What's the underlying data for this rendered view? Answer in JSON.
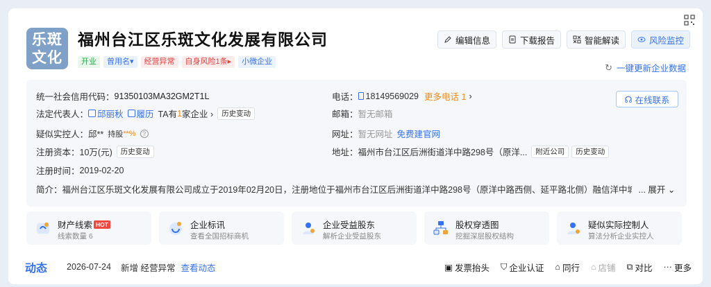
{
  "header": {
    "logo_text_line1": "乐斑",
    "logo_text_line2": "文化",
    "company_name": "福州台江区乐斑文化发展有限公司",
    "tags": [
      {
        "label": "开业",
        "style": "green"
      },
      {
        "label": "曾用名▾",
        "style": "blue"
      },
      {
        "label": "经营异常",
        "style": "red"
      },
      {
        "label": "自身风险1条▸",
        "style": "red"
      },
      {
        "label": "小微企业",
        "style": "blue"
      }
    ],
    "actions": [
      {
        "label": "编辑信息",
        "icon": "edit-icon"
      },
      {
        "label": "下载报告",
        "icon": "document-icon"
      },
      {
        "label": "智能解读",
        "icon": "ai-icon"
      },
      {
        "label": "风险监控",
        "icon": "eye-icon"
      }
    ],
    "refresh_label": "一键更新企业数据"
  },
  "info": {
    "credit_code_label": "统一社会信用代码：",
    "credit_code": "91350103MA32GM2T1L",
    "legal_rep_label": "法定代表人：",
    "legal_rep_name": "邱丽秋",
    "legal_rep_resume": "履历",
    "legal_rep_extra_prefix": "TA有",
    "legal_rep_extra_count": "1",
    "legal_rep_extra_suffix": "家企业 ›",
    "history_change": "历史变动",
    "controller_label": "疑似实控人：",
    "controller_name": "邱**",
    "controller_hold": "持股",
    "controller_pct": "**%",
    "capital_label": "注册资本：",
    "capital": "10万(元)",
    "reg_date_label": "注册时间：",
    "reg_date": "2019-02-20",
    "phone_label": "电话：",
    "phone": "18149569029",
    "more_phone": "更多电话 1",
    "email_label": "邮箱：",
    "email": "暂无邮箱",
    "website_label": "网址：",
    "website": "暂无网址",
    "website_link": "免费建官网",
    "address_label": "地址：",
    "address": "福州市台江区后洲街道洋中路298号（原洋...",
    "nearby": "附近公司",
    "intro_label": "简介：",
    "intro": "福州台江区乐斑文化发展有限公司成立于2019年02月20日，注册地位于福州市台江区后洲街道洋中路298号（原洋中路西侧、延平路北侧）融信洋中城（地",
    "expand": "... 展开 ⌄",
    "online_contact": "在线联系"
  },
  "features": [
    {
      "title": "财产线索",
      "badge": "HOT",
      "sub": "线索数量 6",
      "icon": "property-icon"
    },
    {
      "title": "企业标讯",
      "badge": "",
      "sub": "查看全国招标商机",
      "icon": "bid-icon"
    },
    {
      "title": "企业受益股东",
      "badge": "",
      "sub": "解析企业受益股东",
      "icon": "shareholder-icon"
    },
    {
      "title": "股权穿透图",
      "badge": "",
      "sub": "挖掘深层股权结构",
      "icon": "equity-chart-icon"
    },
    {
      "title": "疑似实际控制人",
      "badge": "",
      "sub": "算法分析企业实控人",
      "icon": "controller-icon"
    }
  ],
  "dynamics": {
    "label": "动态",
    "date": "2026-07-24",
    "text": "新增 经营异常",
    "link": "查看动态"
  },
  "tools": [
    {
      "label": "发票抬头",
      "icon": "invoice-icon",
      "enabled": true
    },
    {
      "label": "企业认证",
      "icon": "shield-icon",
      "enabled": true
    },
    {
      "label": "同行",
      "icon": "peer-icon",
      "enabled": true
    },
    {
      "label": "店铺",
      "icon": "store-icon",
      "enabled": false
    },
    {
      "label": "对比",
      "icon": "compare-icon",
      "enabled": true
    },
    {
      "label": "更多",
      "icon": "more-icon",
      "enabled": true
    }
  ],
  "colors": {
    "accent": "#3571f0",
    "orange": "#f08c1a",
    "red": "#e34040",
    "green": "#2ea44f"
  }
}
